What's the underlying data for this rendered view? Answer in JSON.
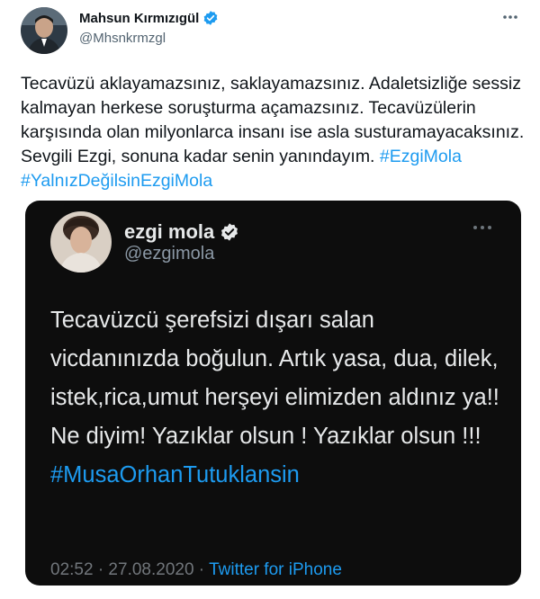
{
  "tweet": {
    "author_name": "Mahsun Kırmızıgül",
    "author_handle": "@Mhsnkrmzgl",
    "more_icon": "more-icon",
    "verified_icon": "verified-badge-icon",
    "text": "Tecavüzü aklayamazsınız, saklayamazsınız.  Adaletsizliğe sessiz kalmayan herkese soruşturma  açamazsınız. Tecavüzülerin karşısında olan milyonlarca insanı ise asla susturamayacaksınız.  Sevgili Ezgi, sonuna kadar senin yanındayım. ",
    "hashtags": "#EzgiMola #YalnızDeğilsinEzgiMola",
    "link_color": "#1d9bf0"
  },
  "embedded": {
    "author_name": "ezgi mola",
    "author_handle": "@ezgimola",
    "text": "Tecavüzcü şerefsizi dışarı salan vicdanınızda boğulun. Artık yasa, dua, dilek, istek,rica,umut herşeyi elimizden aldınız ya!! Ne diyim! Yazıklar olsun ! Yazıklar olsun !!!",
    "hashtag": "#MusaOrhanTutuklansin",
    "timestamp": "02:52 · 27.08.2020 · ",
    "source": "Twitter for iPhone",
    "background": "#0d0d0d"
  }
}
